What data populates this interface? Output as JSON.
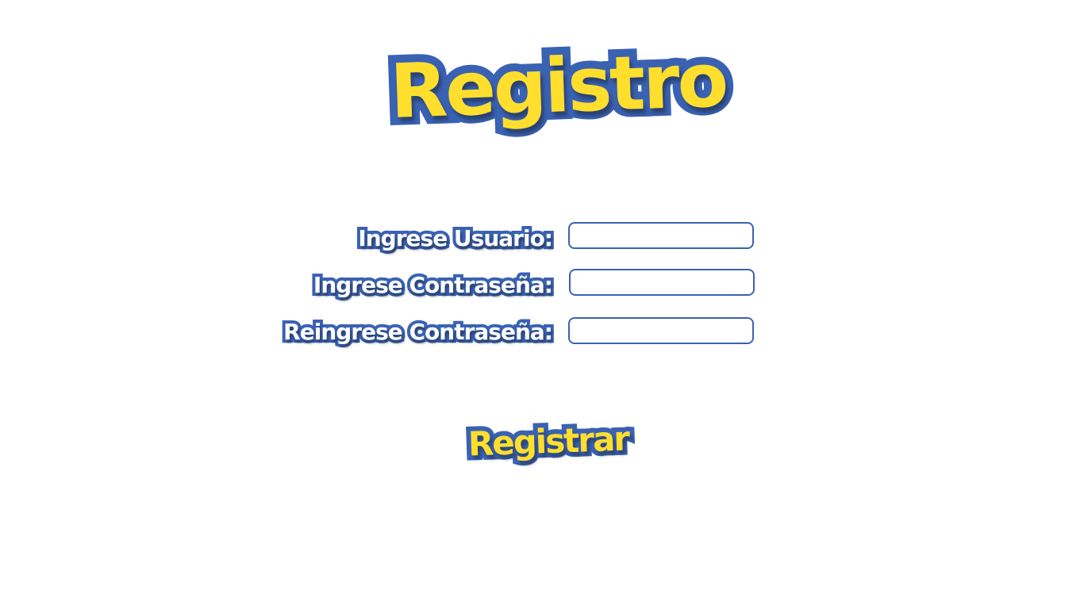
{
  "header": {
    "title": "Registro"
  },
  "form": {
    "fields": [
      {
        "label": "Ingrese Usuario:",
        "value": "",
        "placeholder": ""
      },
      {
        "label": "Ingrese Contraseña:",
        "value": "",
        "placeholder": ""
      },
      {
        "label": "Reingrese Contraseña:",
        "value": "",
        "placeholder": ""
      }
    ],
    "submit_label": "Registrar"
  },
  "colors": {
    "brand_yellow": "#ffde2e",
    "brand_blue": "#3a62b3",
    "background": "#ffffff"
  }
}
